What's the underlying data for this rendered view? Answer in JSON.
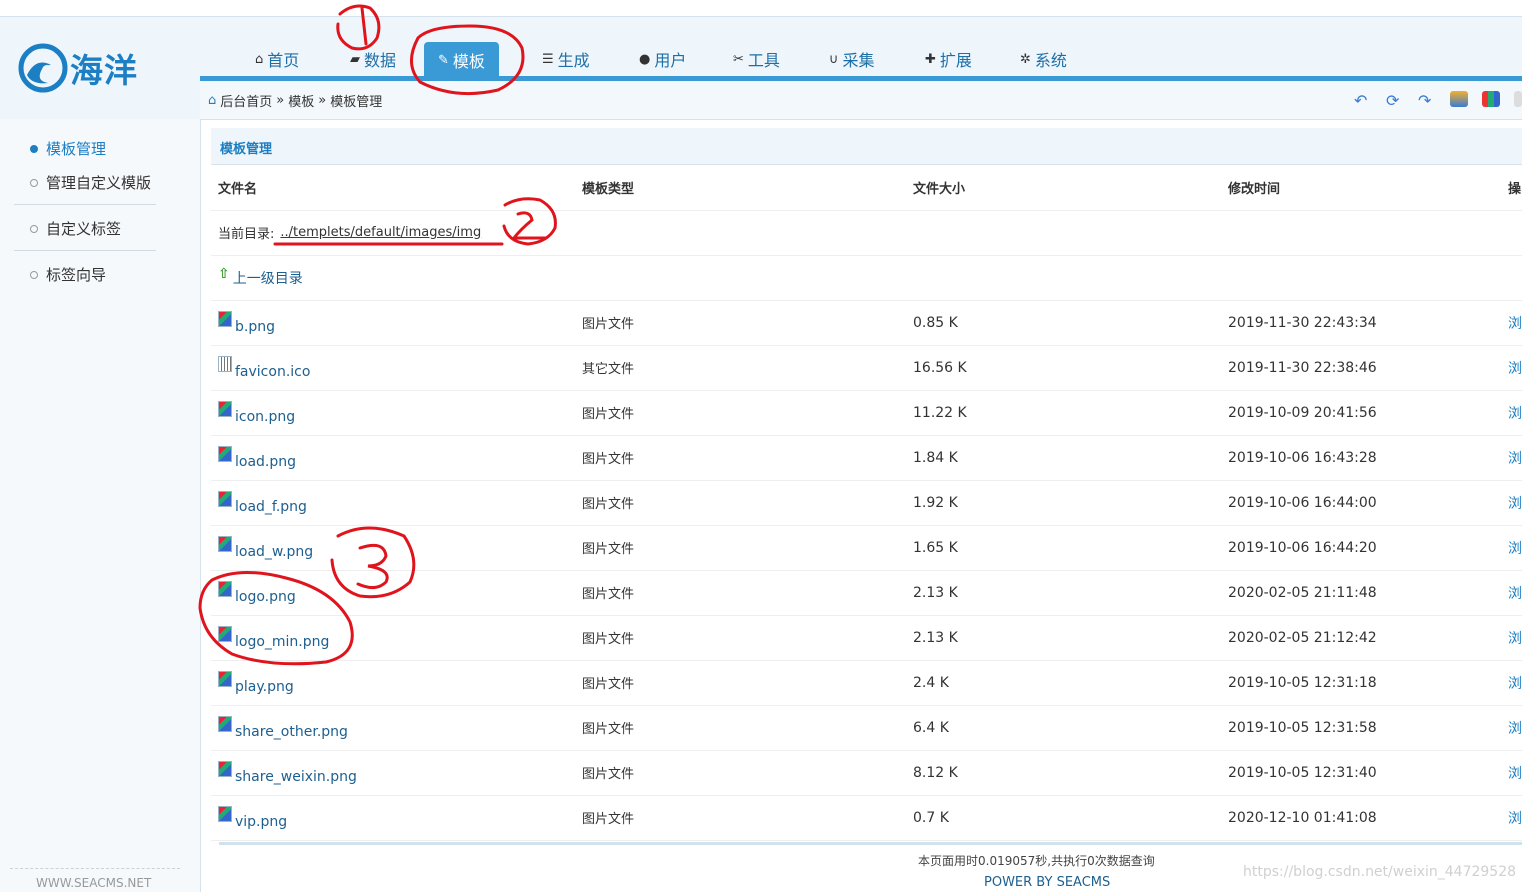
{
  "brand": {
    "name": "海洋"
  },
  "nav": {
    "items": [
      {
        "label": "首页",
        "icon": "home-icon"
      },
      {
        "label": "数据",
        "icon": "book-icon"
      },
      {
        "label": "模板",
        "icon": "edit-icon"
      },
      {
        "label": "生成",
        "icon": "list-icon"
      },
      {
        "label": "用户",
        "icon": "user-icon"
      },
      {
        "label": "工具",
        "icon": "wrench-icon"
      },
      {
        "label": "采集",
        "icon": "magnet-icon"
      },
      {
        "label": "扩展",
        "icon": "puzzle-icon"
      },
      {
        "label": "系统",
        "icon": "gear-icon"
      }
    ],
    "active": "模板"
  },
  "breadcrumb": {
    "home": "后台首页",
    "sep": "»",
    "level1": "模板",
    "level2": "模板管理"
  },
  "sidebar": {
    "items": [
      {
        "label": "模板管理"
      },
      {
        "label": "管理自定义模版"
      },
      {
        "label": "自定义标签"
      },
      {
        "label": "标签向导"
      }
    ],
    "footer": "WWW.SEACMS.NET"
  },
  "panel": {
    "title": "模板管理"
  },
  "table": {
    "headers": [
      "文件名",
      "模板类型",
      "文件大小",
      "修改时间",
      "操"
    ],
    "current_dir_label": "当前目录:",
    "current_dir": "../templets/default/images/img",
    "up_label": "上一级目录",
    "rows": [
      {
        "name": "b.png",
        "type": "图片文件",
        "size": "0.85 K",
        "time": "2019-11-30 22:43:34",
        "op": "浏",
        "kind": "img"
      },
      {
        "name": "favicon.ico",
        "type": "其它文件",
        "size": "16.56 K",
        "time": "2019-11-30 22:38:46",
        "op": "浏",
        "kind": "other"
      },
      {
        "name": "icon.png",
        "type": "图片文件",
        "size": "11.22 K",
        "time": "2019-10-09 20:41:56",
        "op": "浏",
        "kind": "img"
      },
      {
        "name": "load.png",
        "type": "图片文件",
        "size": "1.84 K",
        "time": "2019-10-06 16:43:28",
        "op": "浏",
        "kind": "img"
      },
      {
        "name": "load_f.png",
        "type": "图片文件",
        "size": "1.92 K",
        "time": "2019-10-06 16:44:00",
        "op": "浏",
        "kind": "img"
      },
      {
        "name": "load_w.png",
        "type": "图片文件",
        "size": "1.65 K",
        "time": "2019-10-06 16:44:20",
        "op": "浏",
        "kind": "img"
      },
      {
        "name": "logo.png",
        "type": "图片文件",
        "size": "2.13 K",
        "time": "2020-02-05 21:11:48",
        "op": "浏",
        "kind": "img"
      },
      {
        "name": "logo_min.png",
        "type": "图片文件",
        "size": "2.13 K",
        "time": "2020-02-05 21:12:42",
        "op": "浏",
        "kind": "img"
      },
      {
        "name": "play.png",
        "type": "图片文件",
        "size": "2.4 K",
        "time": "2019-10-05 12:31:18",
        "op": "浏",
        "kind": "img"
      },
      {
        "name": "share_other.png",
        "type": "图片文件",
        "size": "6.4 K",
        "time": "2019-10-05 12:31:58",
        "op": "浏",
        "kind": "img"
      },
      {
        "name": "share_weixin.png",
        "type": "图片文件",
        "size": "8.12 K",
        "time": "2019-10-05 12:31:40",
        "op": "浏",
        "kind": "img"
      },
      {
        "name": "vip.png",
        "type": "图片文件",
        "size": "0.7 K",
        "time": "2020-12-10 01:41:08",
        "op": "浏",
        "kind": "img"
      }
    ]
  },
  "footer": {
    "stats": "本页面用时0.019057秒,共执行0次数据查询",
    "power": "POWER BY SEACMS",
    "watermark": "https://blog.csdn.net/weixin_44729528"
  },
  "colors": {
    "accent": "#3a9ad6",
    "link": "#1d5f8f",
    "annotation": "#e0141c"
  }
}
